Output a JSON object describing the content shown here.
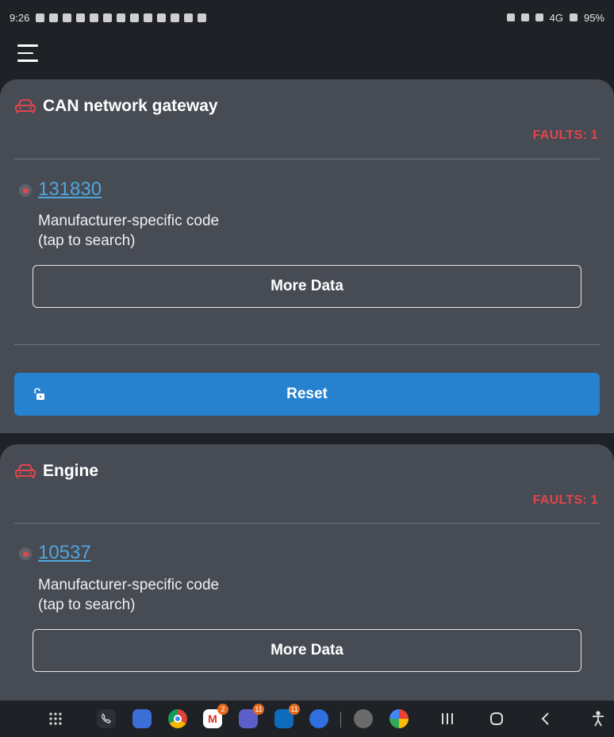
{
  "status_bar": {
    "time": "9:26",
    "network": "4G",
    "battery": "95%"
  },
  "app_bar": {
    "menu_icon": "hamburger-menu-icon"
  },
  "modules": [
    {
      "title": "CAN network gateway",
      "icon": "car-icon",
      "faults_label": "FAULTS: 1",
      "fault": {
        "code": "131830",
        "description_line1": "Manufacturer-specific code",
        "description_line2": "(tap to search)"
      },
      "more_data_label": "More Data",
      "reset_label": "Reset"
    },
    {
      "title": "Engine",
      "icon": "car-icon",
      "faults_label": "FAULTS: 1",
      "fault": {
        "code": "10537",
        "description_line1": "Manufacturer-specific code",
        "description_line2": "(tap to search)"
      },
      "more_data_label": "More Data"
    }
  ],
  "nav_bar": {
    "badges": {
      "gmail": "2",
      "teams": "11",
      "outlook": "11"
    }
  },
  "colors": {
    "background": "#1e2126",
    "card": "#474b54",
    "fault_red": "#e2454b",
    "link_blue": "#4fa6dc",
    "reset_blue": "#2682cf"
  }
}
